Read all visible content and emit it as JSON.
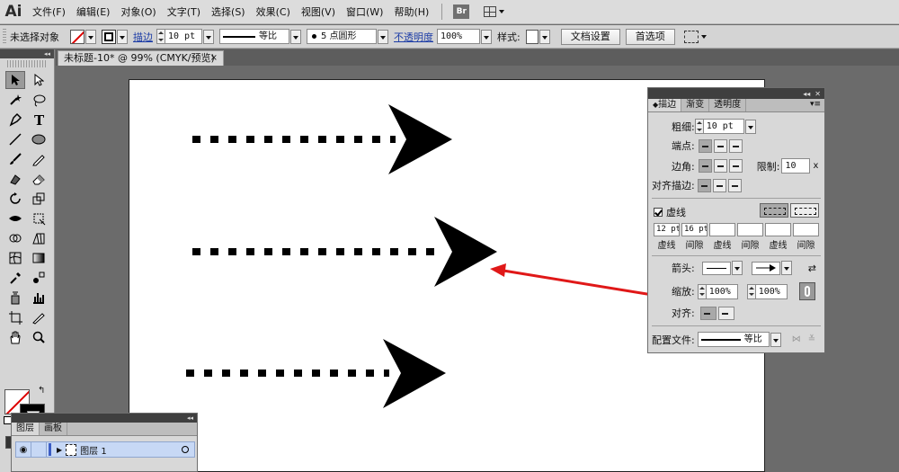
{
  "app": {
    "logo": "Ai",
    "br_badge": "Br"
  },
  "menu": [
    "文件(F)",
    "编辑(E)",
    "对象(O)",
    "文字(T)",
    "选择(S)",
    "效果(C)",
    "视图(V)",
    "窗口(W)",
    "帮助(H)"
  ],
  "control_bar": {
    "selection_status": "未选择对象",
    "stroke_label": "描边",
    "stroke_weight": "10 pt",
    "profile_label": "等比",
    "brush_label": "5 点圆形",
    "opacity_label": "不透明度",
    "opacity_value": "100%",
    "style_label": "样式",
    "doc_setup_button": "文档设置",
    "preferences_button": "首选项"
  },
  "document_tab": {
    "title": "未标题-10* @ 99% (CMYK/预览)",
    "close": "×"
  },
  "stroke_panel": {
    "tabs": [
      "描边",
      "渐变",
      "透明度"
    ],
    "weight_label": "粗细:",
    "weight_value": "10 pt",
    "cap_label": "端点:",
    "corner_label": "边角:",
    "limit_label": "限制:",
    "limit_value": "10",
    "limit_unit": "x",
    "align_stroke_label": "对齐描边:",
    "dashed_label": "虚线",
    "dash_values": [
      "12 pt",
      "16 pt",
      "",
      "",
      "",
      ""
    ],
    "dash_captions": [
      "虚线",
      "间隙",
      "虚线",
      "间隙",
      "虚线",
      "间隙"
    ],
    "arrowhead_label": "箭头:",
    "scale_label": "缩放:",
    "scale_start": "100%",
    "scale_end": "100%",
    "align_label": "对齐:",
    "profile_label": "配置文件:",
    "profile_value": "等比"
  },
  "layers_panel": {
    "tabs": [
      "图层",
      "画板"
    ],
    "layer_name": "图层 1"
  },
  "colors": {
    "annotation_arrow": "#e01818",
    "artwork": "#000000",
    "selected_layer": "#c7d8f5"
  }
}
